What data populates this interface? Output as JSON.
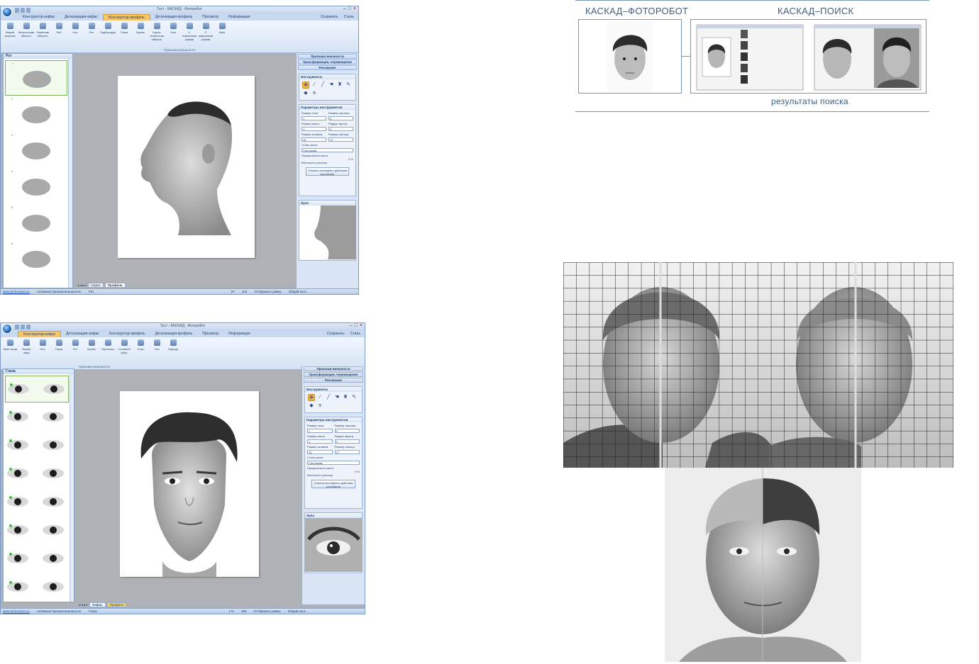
{
  "screenshot1": {
    "window_title": "Тест - КАСКАД - Фоторобот",
    "tabs": [
      "Конструктор-анфас",
      "Детализация-анфас",
      "Конструктор-профиль",
      "Детализация-профиль",
      "Просмотр",
      "Информация"
    ],
    "active_tab": "Конструктор-профиль",
    "top_right": [
      "Сохранить",
      "Стиль"
    ],
    "ribbon_buttons": [
      "Форма затылка",
      "Затылочная область",
      "Теменная область",
      "Лоб",
      "Нос",
      "Рот",
      "Подбородок",
      "Глаза",
      "Брови",
      "Скуло-челюстная область",
      "Уши",
      "С открытыми ушами",
      "С закрытыми ушами",
      "Шея"
    ],
    "ribbon_group": "Признаки внешности",
    "left_panel_title": "Рот",
    "thumb_numbers": [
      "1",
      "2",
      "3",
      "4",
      "5",
      "6"
    ],
    "right_bars": [
      "Признаки внешности",
      "Трансформация, перемещение",
      "Рисование"
    ],
    "tools_title": "Инструменты",
    "params_title": "Параметры инструментов",
    "params": {
      "eraser_size": "Размер ластика",
      "shadow_size": "Размер тени",
      "brush_size": "Размер кисти",
      "blur_radius": "Радиус акрогр.",
      "stamp_size": "Размер штампа",
      "finger_size": "Размер пальца",
      "brush_style": "Стиль кисти",
      "brush_style_value": "Сплошная",
      "opacity": "Прозрачность кисти",
      "opacity_value": "0 %",
      "hardness": "Жесткость (ластик)",
      "undo_button": "Отмена последнего действия рисования",
      "v1": "1",
      "v2": "5",
      "v3": "1",
      "v4": "3",
      "v5": "10",
      "v6": "17"
    },
    "loupe_title": "Лупа",
    "sheet_tabs": [
      "Анфас",
      "Профиль"
    ],
    "status": {
      "link": "www.technoserv.ru",
      "label": "Активный признак внешности:",
      "value": "Рот",
      "zoom1": "97",
      "zoom2": "104",
      "fit": "Отобразить рамку",
      "total": "Общий конт..."
    }
  },
  "screenshot2": {
    "window_title": "Тест - КАСКАД - Фоторобот",
    "tabs": [
      "Конструктор-анфас",
      "Детализация-анфас",
      "Конструктор-профиль",
      "Детализация-профиль",
      "Просмотр",
      "Информация"
    ],
    "active_tab": "Конструктор-анфас",
    "top_right": [
      "Сохранить",
      "Стиль"
    ],
    "ribbon_buttons": [
      "Овал лица",
      "Форма лица",
      "Нос",
      "Глаза",
      "Рот",
      "Брови",
      "Прическа",
      "Головной убор",
      "Очки",
      "Усы",
      "Борода"
    ],
    "ribbon_group": "Признаки внешности",
    "left_panel_title": "Глаза",
    "right_bars": [
      "Признаки внешности",
      "Трансформация, перемещение",
      "Рисование"
    ],
    "tools_title": "Инструменты",
    "params_title": "Параметры инструментов",
    "loupe_title": "Лупа",
    "sheet_tabs": [
      "Анфас",
      "Профиль"
    ],
    "status": {
      "link": "www.technoserv.ru",
      "label": "Активный признак внешности:",
      "value": "Глаза",
      "zoom1": "171",
      "zoom2": "106",
      "fit": "Отобразить рамку",
      "total": "Общий конт..."
    }
  },
  "diagram": {
    "label_left": "КАСКАД–ФОТОРОБОТ",
    "label_right": "КАСКАД–ПОИСК",
    "label_bottom": "результаты поиска"
  },
  "colors": {
    "ribbon": "#d5e3f5",
    "active_tab": "#f6c66a",
    "workspace": "#aeb2b7",
    "diagram_line": "#7895b3"
  }
}
